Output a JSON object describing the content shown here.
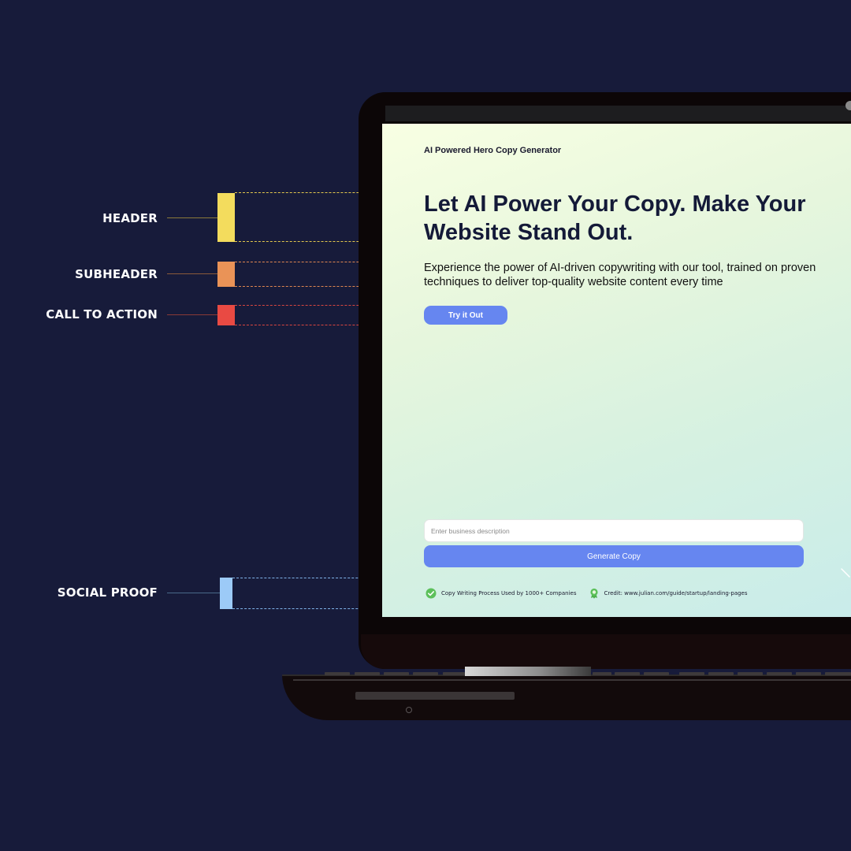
{
  "annotations": [
    {
      "label": "HEADER",
      "color": "#f3dc5d"
    },
    {
      "label": "SUBHEADER",
      "color": "#ea9357"
    },
    {
      "label": "CALL TO ACTION",
      "color": "#e94a43"
    },
    {
      "label": "SOCIAL PROOF",
      "color": "#9ccaf7"
    }
  ],
  "app": {
    "title": "AI Powered Hero Copy Generator",
    "headline": "Let AI Power Your Copy. Make Your Website Stand Out.",
    "subheadline": "Experience the power of AI-driven copywriting with our tool, trained on proven techniques to deliver top-quality website content every time",
    "cta_label": "Try it Out",
    "input_placeholder": "Enter business description",
    "input_value": "",
    "generate_label": "Generate Copy",
    "accent_color": "#6686f0"
  },
  "social_proof": [
    {
      "icon": "check-circle-icon",
      "text": "Copy Writing Process Used by 1000+ Companies"
    },
    {
      "icon": "award-badge-icon",
      "text": "Credit: www.julian.com/guide/startup/landing-pages"
    }
  ]
}
